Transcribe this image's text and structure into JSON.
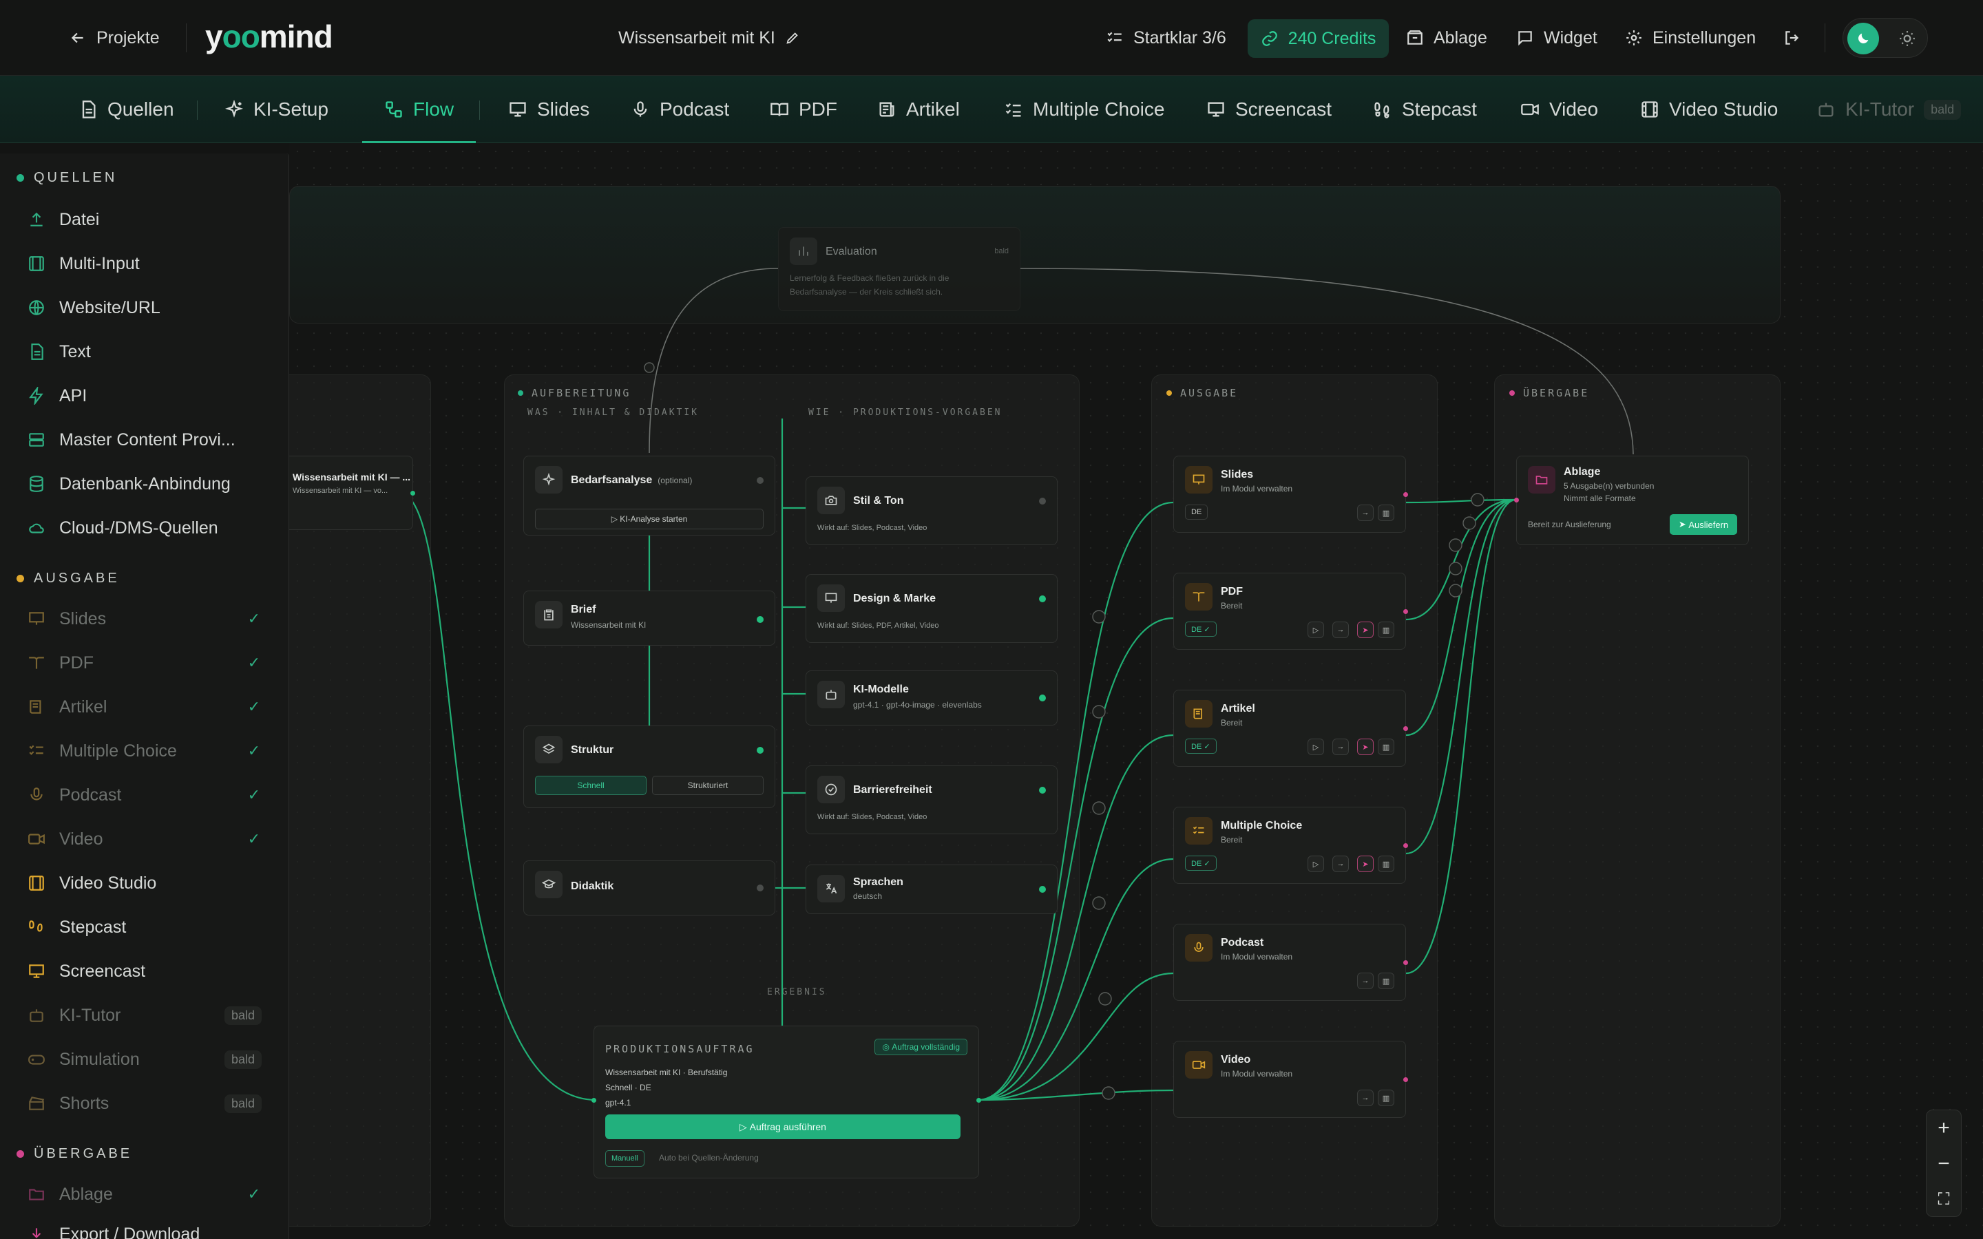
{
  "header": {
    "back_label": "Projekte",
    "brand_prefix": "y",
    "brand_oo": "oo",
    "brand_suffix": "mind",
    "project_title": "Wissensarbeit mit KI",
    "startklar": "Startklar 3/6",
    "credits": "240 Credits",
    "ablage": "Ablage",
    "widget": "Widget",
    "settings": "Einstellungen"
  },
  "tabs": {
    "quellen": "Quellen",
    "ki_setup": "KI-Setup",
    "flow": "Flow",
    "slides": "Slides",
    "podcast": "Podcast",
    "pdf": "PDF",
    "artikel": "Artikel",
    "multiple_choice": "Multiple Choice",
    "screencast": "Screencast",
    "stepcast": "Stepcast",
    "video": "Video",
    "video_studio": "Video Studio",
    "ki_tutor": "KI-Tutor",
    "bald": "bald"
  },
  "sidebar": {
    "quellen_title": "QUELLEN",
    "quellen": [
      "Datei",
      "Multi-Input",
      "Website/URL",
      "Text",
      "API",
      "Master Content Provi...",
      "Datenbank-Anbindung",
      "Cloud-/DMS-Quellen"
    ],
    "ausgabe_title": "AUSGABE",
    "ausgabe": [
      "Slides",
      "PDF",
      "Artikel",
      "Multiple Choice",
      "Podcast",
      "Video",
      "Video Studio",
      "Stepcast",
      "Screencast",
      "KI-Tutor",
      "Simulation",
      "Shorts"
    ],
    "check": "✓",
    "bald": "bald",
    "uebergabe_title": "ÜBERGABE",
    "uebergabe": [
      "Ablage",
      "Export / Download"
    ]
  },
  "canvas": {
    "evaluation": {
      "title": "Evaluation",
      "badge": "bald",
      "desc1": "Lernerfolg & Feedback fließen zurück in die",
      "desc2": "Bedarfsanalyse — der Kreis schließt sich."
    },
    "source_node": {
      "title": "Wissensarbeit mit KI — ...",
      "subtitle": "Wissensarbeit mit KI — vo..."
    },
    "aufbereitung": {
      "title": "AUFBEREITUNG",
      "was": "WAS · INHALT & DIDAKTIK",
      "wie": "WIE · PRODUKTIONS-VORGABEN",
      "ergebnis": "ERGEBNIS"
    },
    "bedarf": {
      "title": "Bedarfsanalyse",
      "optional": "(optional)",
      "button": "KI-Analyse starten"
    },
    "brief": {
      "title": "Brief",
      "subtitle": "Wissensarbeit mit KI"
    },
    "struktur": {
      "title": "Struktur",
      "opt1": "Schnell",
      "opt2": "Strukturiert"
    },
    "didaktik": {
      "title": "Didaktik"
    },
    "stil": {
      "title": "Stil & Ton",
      "subtitle": "Wirkt auf: Slides, Podcast, Video"
    },
    "design": {
      "title": "Design & Marke",
      "subtitle": "Wirkt auf: Slides, PDF, Artikel, Video"
    },
    "ki_modelle": {
      "title": "KI-Modelle",
      "subtitle": "gpt-4.1 · gpt-4o-image · elevenlabs"
    },
    "barriere": {
      "title": "Barrierefreiheit",
      "subtitle": "Wirkt auf: Slides, Podcast, Video"
    },
    "sprachen": {
      "title": "Sprachen",
      "subtitle": "deutsch"
    },
    "auftrag": {
      "title": "PRODUKTIONSAUFTRAG",
      "status": "Auftrag vollständig",
      "line1": "Wissensarbeit mit KI · Berufstätig",
      "line2": "Schnell · DE",
      "line3": "gpt-4.1",
      "run": "Auftrag ausführen",
      "mode1": "Manuell",
      "mode2": "Auto bei Quellen-Änderung"
    },
    "ausgabe_title": "AUSGABE",
    "outputs": [
      {
        "title": "Slides",
        "subtitle": "Im Modul verwalten",
        "lang": "DE"
      },
      {
        "title": "PDF",
        "subtitle": "Bereit",
        "lang": "DE ✓"
      },
      {
        "title": "Artikel",
        "subtitle": "Bereit",
        "lang": "DE ✓"
      },
      {
        "title": "Multiple Choice",
        "subtitle": "Bereit",
        "lang": "DE ✓"
      },
      {
        "title": "Podcast",
        "subtitle": "Im Modul verwalten",
        "lang": ""
      },
      {
        "title": "Video",
        "subtitle": "Im Modul verwalten",
        "lang": ""
      }
    ],
    "uebergabe_title": "ÜBERGABE",
    "ablage": {
      "title": "Ablage",
      "line1": "5 Ausgabe(n) verbunden",
      "line2": "Nimmt alle Formate",
      "ready": "Bereit zur Auslieferung",
      "button": "Ausliefern"
    }
  },
  "colors": {
    "accent": "#24b486",
    "ausgabe_dot": "#e0a82e",
    "uebergabe_dot": "#d2458e"
  }
}
